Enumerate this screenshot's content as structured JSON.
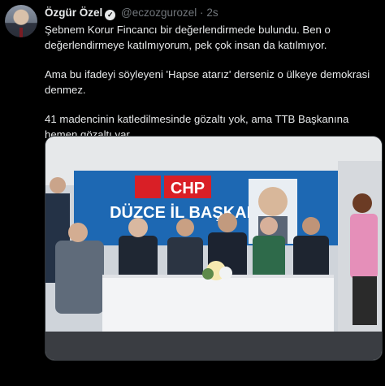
{
  "tweet": {
    "author_name": "Özgür Özel",
    "verified_icon": "verified-badge-icon",
    "handle": "@eczozgurozel",
    "separator": "·",
    "time": "2s",
    "paragraphs": [
      "Şebnem Korur Fincancı bir değerlendirmede bulundu. Ben o değerlendirmeye katılmıyorum, pek çok insan da katılmıyor.",
      "Ama bu ifadeyi söyleyeni 'Hapse atarız' derseniz o ülkeye demokrasi denmez.",
      "41 madencinin katledilmesinde gözaltı yok, ama TTB Başkanına hemen gözaltı var."
    ]
  },
  "media": {
    "banner_text_chp": "CHP",
    "banner_text_city": "DÜZCE İL BAŞKANLIĞI",
    "colors": {
      "banner_blue": "#1d68b3",
      "chp_red": "#d91f26",
      "table_cloth": "#f3f4f6"
    }
  }
}
